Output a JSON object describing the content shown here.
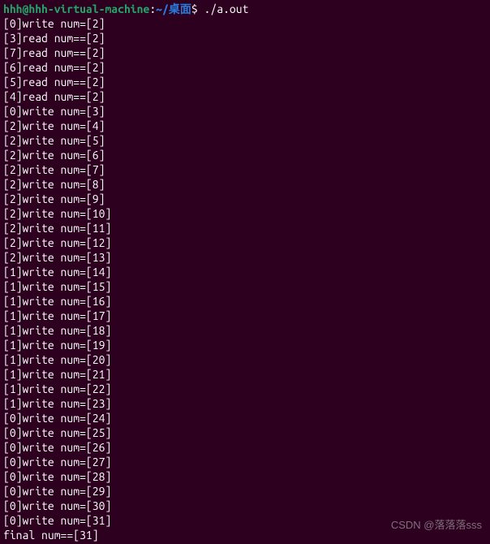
{
  "prompt": {
    "user_host": "hhh@hhh-virtual-machine",
    "colon": ":",
    "path": "~/桌面",
    "dollar": "$ ",
    "command": "./a.out"
  },
  "lines": [
    "[0]write num=[2]",
    "[3]read num==[2]",
    "[7]read num==[2]",
    "[6]read num==[2]",
    "[5]read num==[2]",
    "[4]read num==[2]",
    "[0]write num=[3]",
    "[2]write num=[4]",
    "[2]write num=[5]",
    "[2]write num=[6]",
    "[2]write num=[7]",
    "[2]write num=[8]",
    "[2]write num=[9]",
    "[2]write num=[10]",
    "[2]write num=[11]",
    "[2]write num=[12]",
    "[2]write num=[13]",
    "[1]write num=[14]",
    "[1]write num=[15]",
    "[1]write num=[16]",
    "[1]write num=[17]",
    "[1]write num=[18]",
    "[1]write num=[19]",
    "[1]write num=[20]",
    "[1]write num=[21]",
    "[1]write num=[22]",
    "[1]write num=[23]",
    "[0]write num=[24]",
    "[0]write num=[25]",
    "[0]write num=[26]",
    "[0]write num=[27]",
    "[0]write num=[28]",
    "[0]write num=[29]",
    "[0]write num=[30]",
    "[0]write num=[31]",
    "final num==[31]"
  ],
  "watermark": "CSDN @落落落sss"
}
